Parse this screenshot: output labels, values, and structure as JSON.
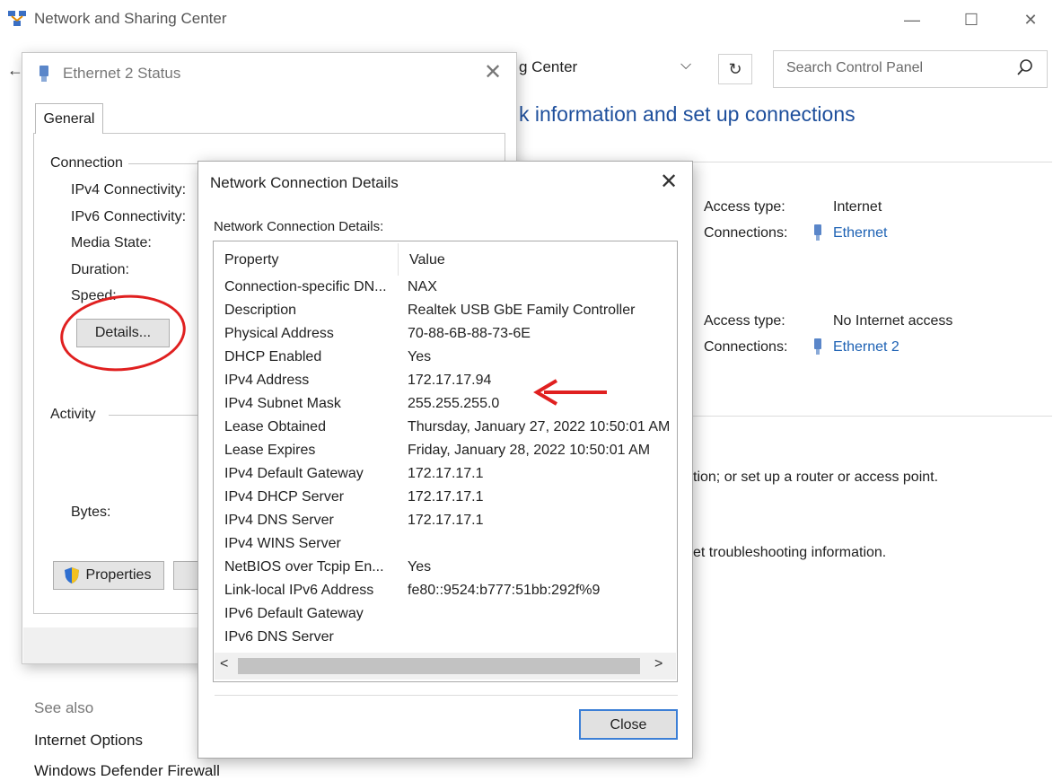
{
  "window": {
    "title": "Network and Sharing Center",
    "minimize": "—",
    "maximize": "☐",
    "close": "✕"
  },
  "addressbar": {
    "visible_text": "g Center",
    "refresh": "↻"
  },
  "search": {
    "placeholder": "Search Control Panel"
  },
  "main": {
    "heading_partial": "k information and set up connections",
    "net1": {
      "access_label": "Access type:",
      "access_value": "Internet",
      "conn_label": "Connections:",
      "conn_link": "Ethernet"
    },
    "net2": {
      "access_label": "Access type:",
      "access_value": "No Internet access",
      "conn_label": "Connections:",
      "conn_link": "Ethernet 2"
    },
    "text1": "tion; or set up a router or access point.",
    "text2": "et troubleshooting information."
  },
  "see_also": {
    "heading": "See also",
    "items": [
      "Internet Options",
      "Windows Defender Firewall"
    ]
  },
  "status_dialog": {
    "title": "Ethernet 2 Status",
    "close": "✕",
    "tab": "General",
    "connection_group": "Connection",
    "labels": [
      "IPv4 Connectivity:",
      "IPv6 Connectivity:",
      "Media State:",
      "Duration:",
      "Speed:"
    ],
    "details_button": "Details...",
    "activity_group": "Activity",
    "bytes_label": "Bytes:",
    "properties_button": "Properties"
  },
  "details_dialog": {
    "title": "Network Connection Details",
    "close": "✕",
    "group_label": "Network Connection Details:",
    "col_property": "Property",
    "col_value": "Value",
    "rows": [
      {
        "p": "Connection-specific DN...",
        "v": "NAX"
      },
      {
        "p": "Description",
        "v": "Realtek USB GbE Family Controller"
      },
      {
        "p": "Physical Address",
        "v": "70-88-6B-88-73-6E"
      },
      {
        "p": "DHCP Enabled",
        "v": "Yes"
      },
      {
        "p": "IPv4 Address",
        "v": "172.17.17.94"
      },
      {
        "p": "IPv4 Subnet Mask",
        "v": "255.255.255.0"
      },
      {
        "p": "Lease Obtained",
        "v": "Thursday, January 27, 2022 10:50:01 AM"
      },
      {
        "p": "Lease Expires",
        "v": "Friday, January 28, 2022 10:50:01 AM"
      },
      {
        "p": "IPv4 Default Gateway",
        "v": "172.17.17.1"
      },
      {
        "p": "IPv4 DHCP Server",
        "v": "172.17.17.1"
      },
      {
        "p": "IPv4 DNS Server",
        "v": "172.17.17.1"
      },
      {
        "p": "IPv4 WINS Server",
        "v": ""
      },
      {
        "p": "NetBIOS over Tcpip En...",
        "v": "Yes"
      },
      {
        "p": "Link-local IPv6 Address",
        "v": "fe80::9524:b777:51bb:292f%9"
      },
      {
        "p": "IPv6 Default Gateway",
        "v": ""
      },
      {
        "p": "IPv6 DNS Server",
        "v": ""
      }
    ],
    "scroll_left": "<",
    "scroll_right": ">",
    "close_button": "Close"
  },
  "colors": {
    "link": "#1e62b4",
    "heading": "#1e4f9c",
    "annotation_red": "#e02020"
  }
}
